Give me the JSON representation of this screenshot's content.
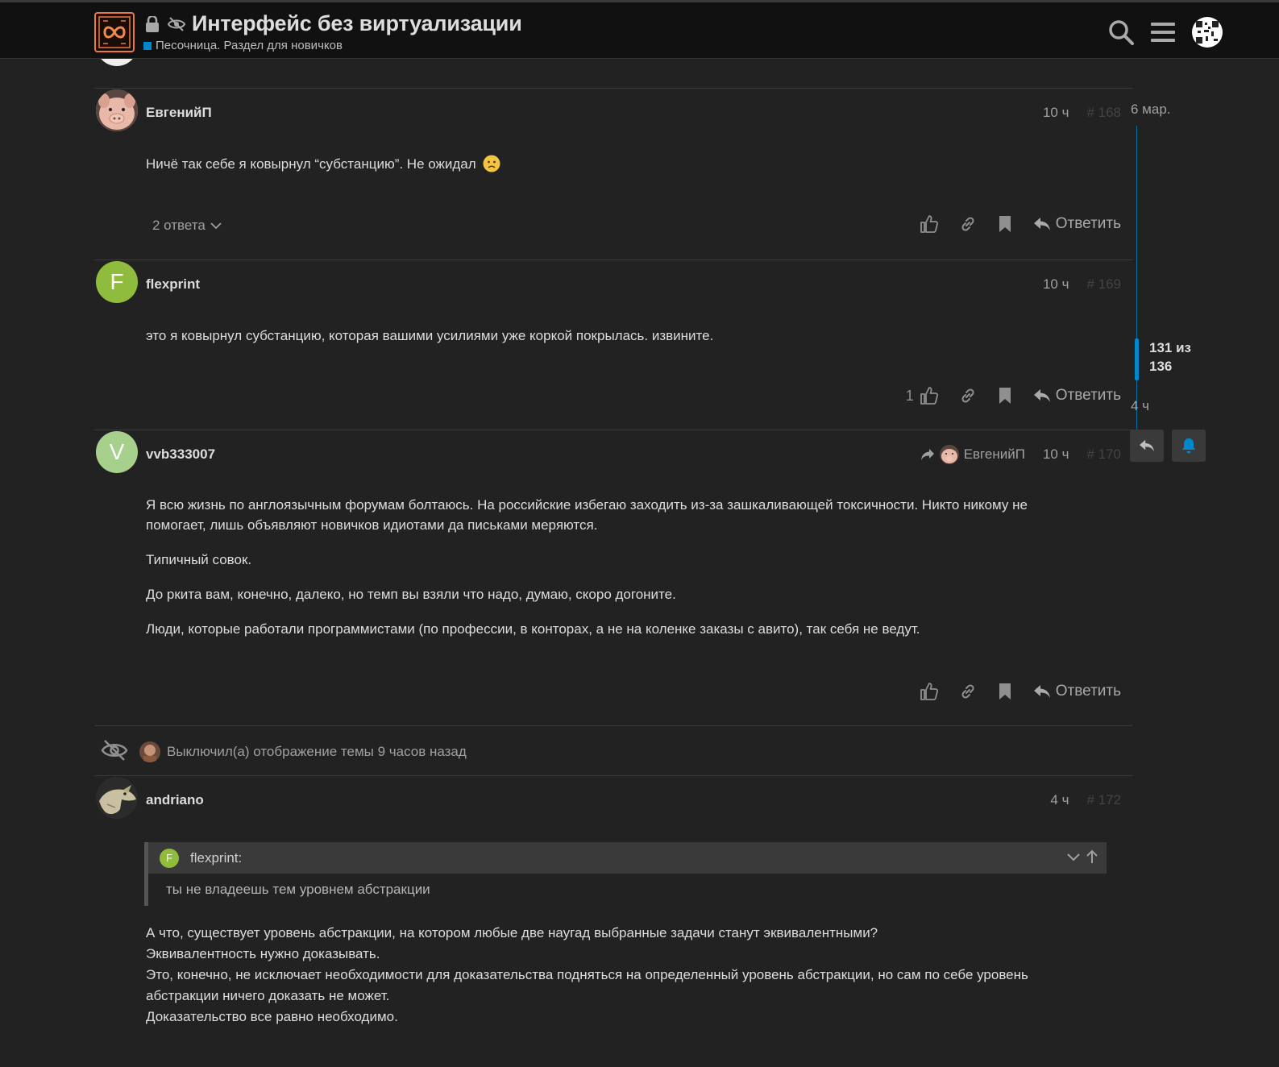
{
  "header": {
    "title": "Интерфейс без виртуализации",
    "category": "Песочница. Раздел для новичков",
    "category_color": "#0088cc",
    "icons": [
      "lock-icon",
      "eye-slash-icon",
      "search-icon",
      "hamburger-menu-icon"
    ]
  },
  "posts": [
    {
      "username": "ЕвгенийП",
      "time": "10 ч",
      "number": "# 168",
      "body": [
        "Ничё так себе я ковырнул “субстанцию”. Не ожидал"
      ],
      "emoji": "slightly-frowning-face",
      "replies_toggle": "2 ответа",
      "likes": "",
      "reply_label": "Ответить"
    },
    {
      "username": "flexprint",
      "avatar_letter": "F",
      "avatar_color": "#8fbc3c",
      "time": "10 ч",
      "number": "# 169",
      "body": [
        "это я ковырнул субстанцию, которая вашими усилиями уже коркой покрылась. извините."
      ],
      "likes": "1",
      "reply_label": "Ответить"
    },
    {
      "username": "vvb333007",
      "avatar_letter": "V",
      "avatar_color": "#a6d08b",
      "reply_to": "ЕвгенийП",
      "time": "10 ч",
      "number": "# 170",
      "body": [
        "Я всю жизнь по англоязычным форумам болтаюсь. На российские избегаю заходить из-за зашкаливающей токсичности. Никто никому не помогает, лишь объявляют новичков идиотами да письками меряются.",
        "Типичный совок.",
        "До ркита вам, конечно, далеко, но темп вы взяли что надо, думаю, скоро догоните.",
        "Люди, которые работали программистами (по профессии, в конторах, а не на коленке заказы с авито), так себя не ведут."
      ],
      "reply_label": "Ответить"
    },
    {
      "username": "andriano",
      "time": "4 ч",
      "number": "# 172",
      "quote": {
        "author": "flexprint",
        "author_letter": "F",
        "text": "ты не владеешь тем уровнем абстракции"
      },
      "body": [
        "А что, существует уровень абстракции, на котором любые две наугад выбранные задачи станут эквивалентными?",
        "Эквивалентность нужно доказывать.",
        "Это, конечно, не исключает необходимости для доказательства подняться на определенный уровень абстракции, но сам по себе уровень абстракции ничего доказать не может.",
        "Доказательство все равно необходимо."
      ]
    }
  ],
  "small_action": {
    "text": "Выключил(а) отображение темы 9 часов назад"
  },
  "timeline": {
    "date_top": "6 мар.",
    "position_line1": "131 из",
    "position_line2": "136",
    "date_bottom": "4 ч"
  }
}
